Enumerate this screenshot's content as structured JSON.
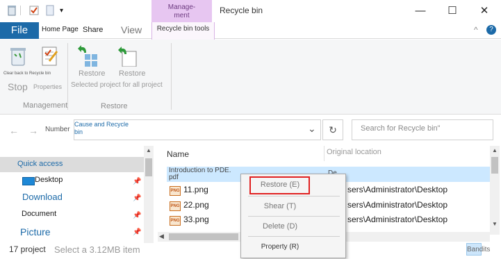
{
  "titlebar": {
    "contextual_group": "Manage-\nment",
    "window_title": "Recycle bin",
    "minimize": "—",
    "maximize": "☐",
    "close": "✕"
  },
  "tabs": {
    "file": "File",
    "home": "Home Page",
    "share": "Share",
    "view": "View",
    "contextual": "Recycle bin tools",
    "collapse": "^",
    "help": "?"
  },
  "ribbon": {
    "empty_caption": "Clear back to Recycle bin",
    "stop": "Stop",
    "properties": "Properties",
    "restore_all": "Restore",
    "restore_selected": "Restore",
    "selected_for_all": "Selected project for all project",
    "group_management": "Management",
    "group_restore": "Restore"
  },
  "address": {
    "back": "←",
    "forward": "→",
    "number_label": "Number",
    "path_line1": "Cause and Recycle",
    "path_line2": "bin",
    "dropdown": "⌄",
    "refresh": "↻",
    "search_placeholder": "Search for Recycle bin\""
  },
  "nav": {
    "quick_access": "Quick access",
    "desktop": "Desktop",
    "download": "Download",
    "document": "Document",
    "picture": "Picture"
  },
  "list": {
    "col_name": "Name",
    "col_location": "Original location",
    "rows": [
      {
        "name": "Introduction to PDE.\npdf",
        "location": "De"
      },
      {
        "name": "11.png",
        "location": "sers\\Administrator\\Desktop"
      },
      {
        "name": "22.png",
        "location": "sers\\Administrator\\Desktop"
      },
      {
        "name": "33.png",
        "location": "sers\\Administrator\\Desktop"
      }
    ],
    "png_badge": "PNG"
  },
  "context_menu": {
    "restore": "Restore (E)",
    "shear": "Shear (T)",
    "delete": "Delete (D)",
    "property": "Property (R)"
  },
  "status": {
    "count": "17 project",
    "selection": "Select a 3.12MB item",
    "view_label": "Bandits"
  },
  "colors": {
    "file_tab": "#1c6aa8",
    "contextual_tab": "#e7c6f1",
    "selection": "#cce8ff",
    "highlight_box": "#e02020"
  }
}
